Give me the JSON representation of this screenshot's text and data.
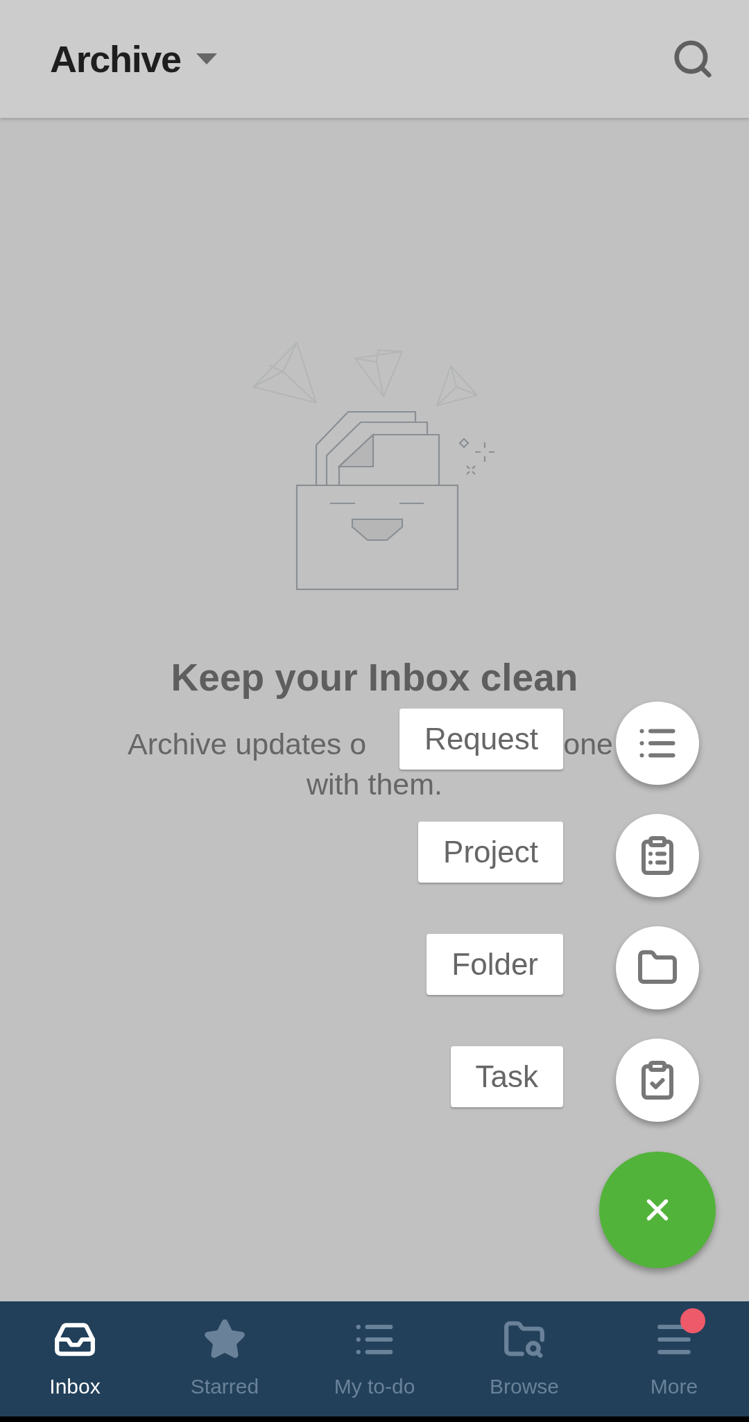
{
  "header": {
    "title": "Archive"
  },
  "empty_state": {
    "headline": "Keep your Inbox clean",
    "description_visible_parts": [
      "Archive updates o",
      "one"
    ],
    "description_line_2": "with them."
  },
  "fab_menu": {
    "open": true,
    "actions": [
      {
        "label": "Request"
      },
      {
        "label": "Project"
      },
      {
        "label": "Folder"
      },
      {
        "label": "Task"
      }
    ]
  },
  "bottom_nav": [
    {
      "label": "Inbox",
      "selected": true,
      "badge": false
    },
    {
      "label": "Starred",
      "selected": false,
      "badge": false
    },
    {
      "label": "My to-do",
      "selected": false,
      "badge": false
    },
    {
      "label": "Browse",
      "selected": false,
      "badge": false
    },
    {
      "label": "More",
      "selected": false,
      "badge": true
    }
  ]
}
